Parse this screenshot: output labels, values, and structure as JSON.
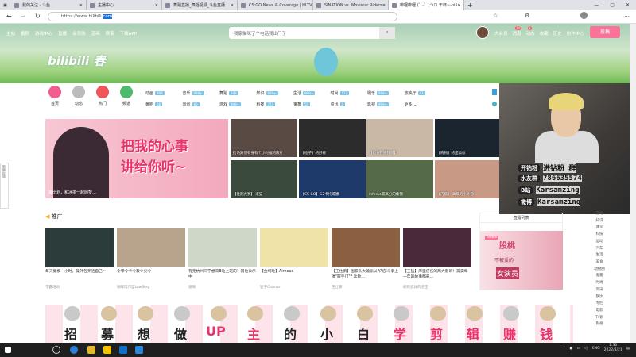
{
  "browser": {
    "tabs": [
      {
        "label": "我的关注 - 斗鱼",
        "active": false
      },
      {
        "label": "主播中心",
        "active": false
      },
      {
        "label": "舞蹈直播_舞蹈视频_斗鱼直播",
        "active": false
      },
      {
        "label": "CS:GO News & Coverage | HLTV",
        "active": false
      },
      {
        "label": "SINATION vs. Movistar Riders",
        "active": false
      },
      {
        "label": "哔哩哔哩 (゜-゜)つロ 干杯~-bili",
        "active": true
      }
    ],
    "new_tab": "+",
    "url_prefix": "https://www.bilibili.",
    "url_selected": "com",
    "window_controls": [
      "—",
      "▢",
      "✕"
    ]
  },
  "header": {
    "nav": [
      "主站",
      "番剧",
      "游戏中心",
      "直播",
      "会员购",
      "漫画",
      "赛事",
      "下载APP"
    ],
    "search_placeholder": "我家猫咪了个电话我出门了",
    "right_nav": [
      "大会员",
      "消息",
      "动态",
      "收藏",
      "历史",
      "创作中心"
    ],
    "message_badge": "10",
    "dynamic_badge": "8",
    "post_button": "投稿",
    "logo": "bilibili 春"
  },
  "quick": [
    {
      "label": "首页",
      "color": "#f25d8e"
    },
    {
      "label": "动态",
      "color": "#bbb"
    },
    {
      "label": "热门",
      "color": "#f0555b"
    },
    {
      "label": "频道",
      "color": "#4fba6c"
    }
  ],
  "categories": [
    [
      {
        "label": "动画",
        "count": "999"
      },
      {
        "label": "音乐",
        "count": "999+"
      },
      {
        "label": "舞蹈",
        "count": "283"
      },
      {
        "label": "知识",
        "count": "999+"
      },
      {
        "label": "生活",
        "count": "999+"
      },
      {
        "label": "时尚",
        "count": "172"
      },
      {
        "label": "娱乐",
        "count": "999+"
      },
      {
        "label": "放映厅",
        "count": "43"
      }
    ],
    [
      {
        "label": "番剧",
        "count": "28"
      },
      {
        "label": "国创",
        "count": "60"
      },
      {
        "label": "游戏",
        "count": "999+"
      },
      {
        "label": "科技",
        "count": "773"
      },
      {
        "label": "鬼畜",
        "count": "55"
      },
      {
        "label": "资讯",
        "count": "2"
      },
      {
        "label": "影视",
        "count": "999+"
      },
      {
        "label": "更多",
        "count": ""
      }
    ]
  ],
  "carousel": {
    "title_line1": "把我的心事",
    "title_line2": "讲给你听~",
    "caption": "来比划，和冰墨一起圆梦…"
  },
  "thumbs": [
    {
      "title": "街访路们有身有个小时候的照片",
      "color": "#5a4a44"
    },
    {
      "title": "【枪子】的好看",
      "color": "#2c2c2c"
    },
    {
      "title": "【也会在视频前】",
      "color": "#c9b8a6"
    },
    {
      "title": "【购物】的是高标",
      "color": "#1a2530"
    },
    {
      "title": "【往期大赛】 老猫",
      "color": "#3a4a3d"
    },
    {
      "title": "【CS GO】G2卡托嫦娥",
      "color": "#1d3a6a"
    },
    {
      "title": "inferno最高分的集锦",
      "color": "#556b48"
    },
    {
      "title": "【内搭】 高级的小外套",
      "color": "#c89a85"
    }
  ],
  "overlay": [
    {
      "key": "开钻粉",
      "value": "进钻粉 群"
    },
    {
      "key": "水友群",
      "value": "786635574"
    },
    {
      "key": "B站",
      "value": "Karsamzing"
    },
    {
      "key": "微博",
      "value": "Karsamzing"
    }
  ],
  "side_float": "新版反馈",
  "promo": {
    "heading": "推广"
  },
  "cards": [
    {
      "title": "每天健模一小时，操外包养活自己~",
      "up": "学霸培训",
      "color": "#2b3c3a",
      "ad": true
    },
    {
      "title": "令零令卡令教令父令",
      "up": "咖啡馆作型LowSing",
      "color": "#b8a48d",
      "ad": false
    },
    {
      "title": "有无杭州同学想来B站上班的？岗位公示中",
      "up": "潮啊",
      "color": "#cfd8c8",
      "ad": true
    },
    {
      "title": "【金坷垃】Airhead",
      "up": "智子Cormar",
      "color": "#efe3a8",
      "ad": false
    },
    {
      "title": "【王仕鹏】国家队大输偷以?内部斗争上演\"握手门\"? 兵败…",
      "up": "王仕鹏",
      "color": "#8a6040",
      "ad": false
    },
    {
      "title": "【王猛】库里倍伤的两大影响！篇实每一年的故事都悬…",
      "up": "呢呢说球的老王",
      "color": "#4a2a3a",
      "ad": false
    }
  ],
  "live": {
    "header": "直播列表",
    "ad_tag": "bilibili",
    "ad_title": "股桃",
    "ad_sub": "不被爱的",
    "ad_sub2": "女演员"
  },
  "right_side": [
    "游戏",
    "知识",
    "课堂",
    "科技",
    "运动",
    "汽车",
    "生活",
    "美食",
    "动物圈",
    "鬼畜",
    "时尚",
    "资讯",
    "娱乐",
    "专栏",
    "电影",
    "TV剧",
    "影视"
  ],
  "bottom_banner": [
    "招",
    "募",
    "想",
    "做",
    "UP",
    "主",
    "的",
    "小",
    "白",
    "学",
    "剪",
    "辑",
    "赚",
    "钱"
  ],
  "taskbar": {
    "lang": "ENG",
    "time": "1:30",
    "date": "2022/3/21"
  }
}
